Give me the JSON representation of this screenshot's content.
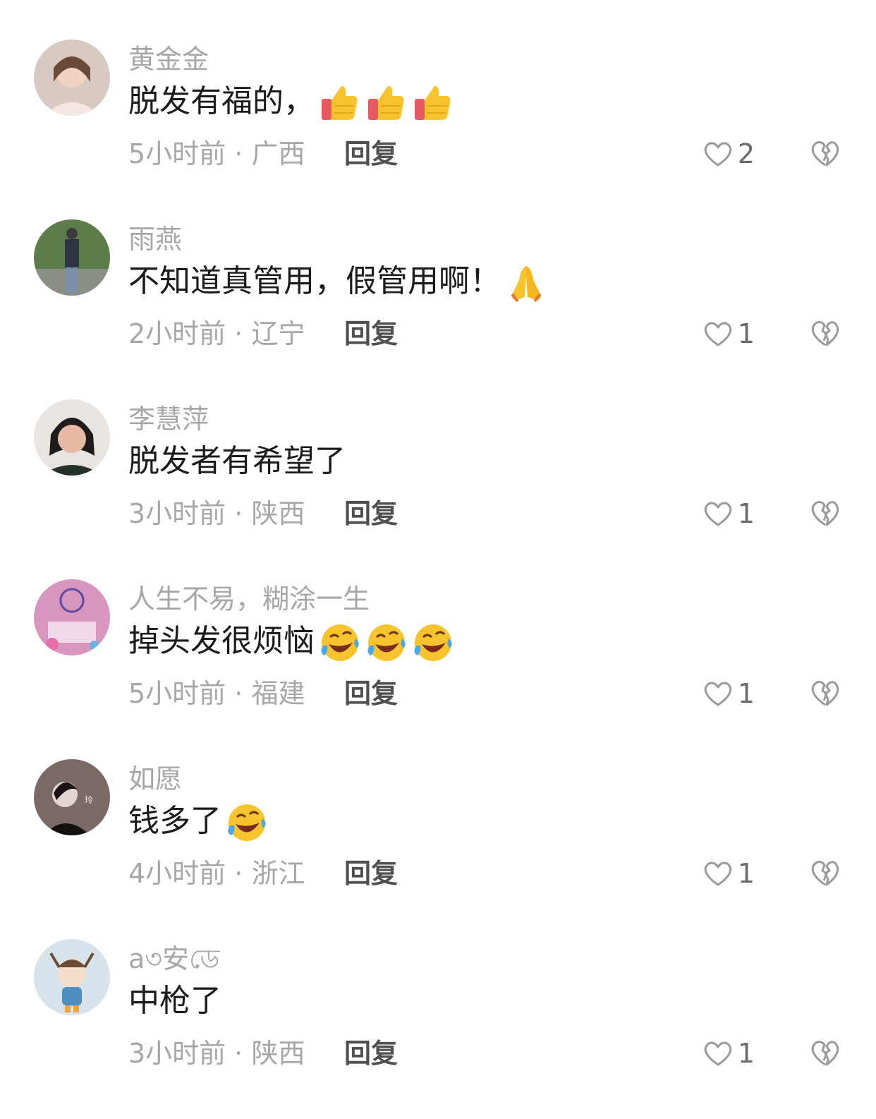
{
  "comments": [
    {
      "username": "黄金金",
      "text": "脱发有福的，",
      "emoji": "thumbs-up",
      "emoji_count": 3,
      "time": "5小时前",
      "location": "广西",
      "reply_label": "回复",
      "likes": "2",
      "avatar_bg": "#d8c9c2"
    },
    {
      "username": "雨燕",
      "text": "不知道真管用，假管用啊！",
      "emoji": "pray",
      "emoji_count": 1,
      "time": "2小时前",
      "location": "辽宁",
      "reply_label": "回复",
      "likes": "1",
      "avatar_bg": "#5c7c4a"
    },
    {
      "username": "李慧萍",
      "text": "脱发者有希望了",
      "emoji": "",
      "emoji_count": 0,
      "time": "3小时前",
      "location": "陕西",
      "reply_label": "回复",
      "likes": "1",
      "avatar_bg": "#e9e4df"
    },
    {
      "username": "人生不易，糊涂一生",
      "text": "掉头发很烦恼",
      "emoji": "rofl",
      "emoji_count": 3,
      "time": "5小时前",
      "location": "福建",
      "reply_label": "回复",
      "likes": "1",
      "avatar_bg": "#d895c0"
    },
    {
      "username": "如愿",
      "text": "钱多了",
      "emoji": "rofl",
      "emoji_count": 1,
      "time": "4小时前",
      "location": "浙江",
      "reply_label": "回复",
      "likes": "1",
      "avatar_bg": "#7a6964"
    },
    {
      "username": "a৩安ডে",
      "text": "中枪了",
      "emoji": "",
      "emoji_count": 0,
      "time": "3小时前",
      "location": "陕西",
      "reply_label": "回复",
      "likes": "1",
      "avatar_bg": "#d6e3ea"
    }
  ],
  "meta_separator": " · ",
  "colors": {
    "text": "#1b1b1b",
    "muted": "#a7a7a7",
    "reply": "#505050"
  }
}
